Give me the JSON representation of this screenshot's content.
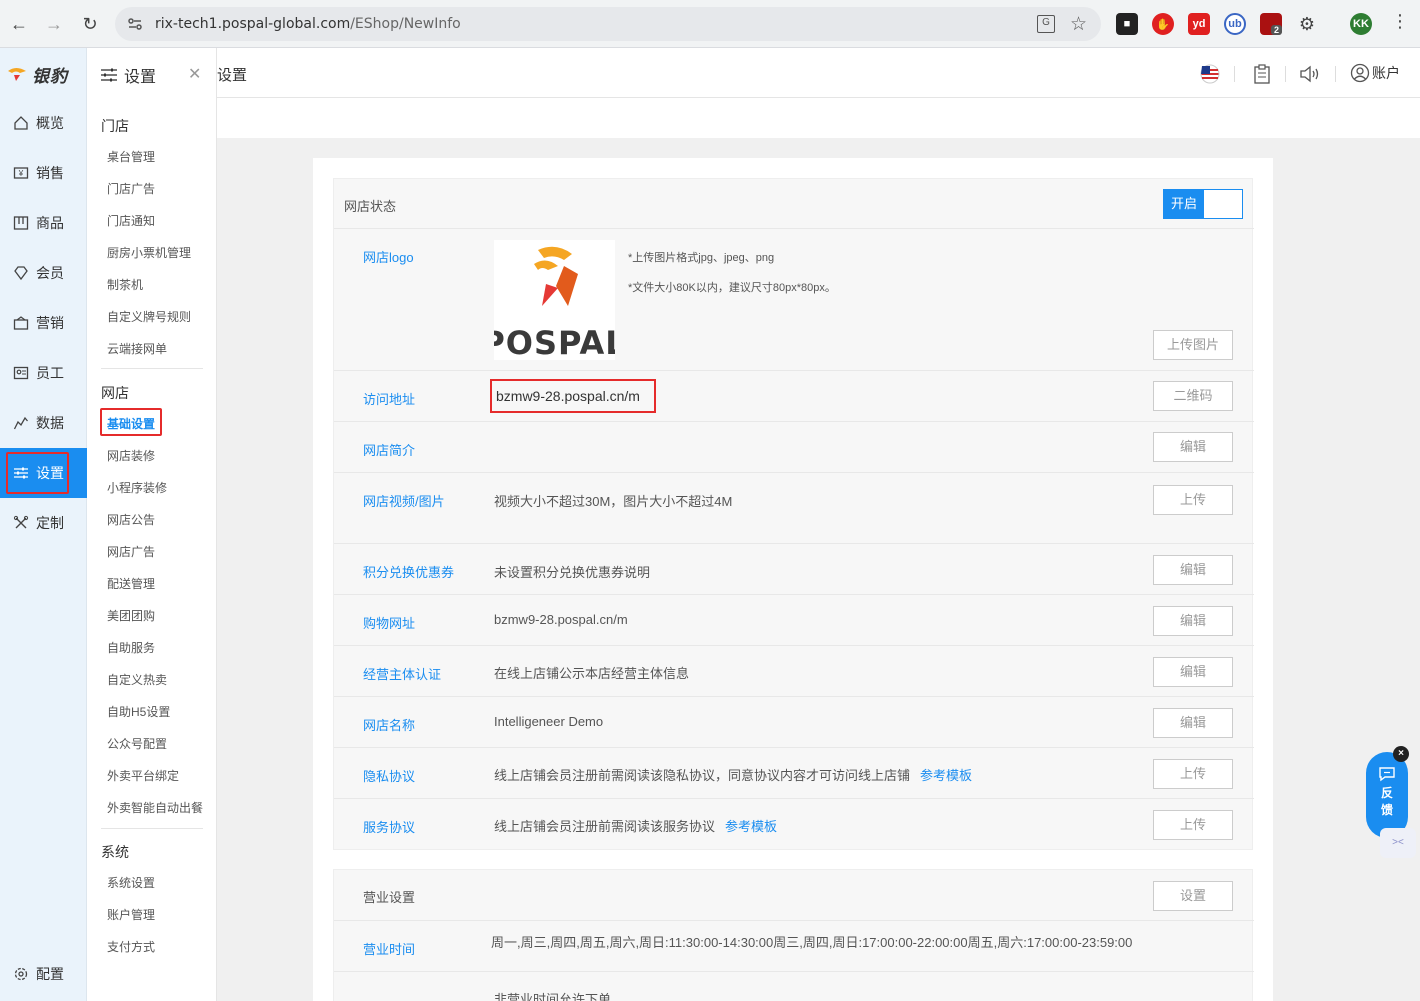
{
  "browser": {
    "url_host": "rix-tech1.pospal-global.com",
    "url_path": "/EShop/NewInfo",
    "profile_initials": "KK",
    "ext_badge": "2",
    "ext_yd_label": "yd",
    "ext_ub_label": "ub"
  },
  "mainnav": {
    "brand": "银豹",
    "items": [
      {
        "label": "概览",
        "icon": "home-icon"
      },
      {
        "label": "销售",
        "icon": "sales-icon"
      },
      {
        "label": "商品",
        "icon": "product-icon"
      },
      {
        "label": "会员",
        "icon": "member-icon"
      },
      {
        "label": "营销",
        "icon": "marketing-icon"
      },
      {
        "label": "员工",
        "icon": "employee-icon"
      },
      {
        "label": "数据",
        "icon": "data-icon"
      },
      {
        "label": "设置",
        "icon": "settings-icon"
      },
      {
        "label": "定制",
        "icon": "custom-icon"
      }
    ],
    "bottom": "配置"
  },
  "subnav": {
    "title": "设置",
    "sections": [
      {
        "title": "门店",
        "items": [
          "桌台管理",
          "门店广告",
          "门店通知",
          "厨房小票机管理",
          "制茶机",
          "自定义牌号规则",
          "云端接网单"
        ]
      },
      {
        "title": "网店",
        "items": [
          "基础设置",
          "网店装修",
          "小程序装修",
          "网店公告",
          "网店广告",
          "配送管理",
          "美团团购",
          "自助服务",
          "自定义热卖",
          "自助H5设置",
          "公众号配置",
          "外卖平台绑定",
          "外卖智能自动出餐"
        ]
      },
      {
        "title": "系统",
        "items": [
          "系统设置",
          "账户管理",
          "支付方式"
        ]
      }
    ]
  },
  "header": {
    "title": "设置",
    "account": "账户"
  },
  "shop": {
    "status_label": "网店状态",
    "toggle_on": "开启",
    "logo_label": "网店logo",
    "logo_text": "POSPAL",
    "logo_hint1": "*上传图片格式jpg、jpeg、png",
    "logo_hint2": "*文件大小80K以内，建议尺寸80px*80px。",
    "upload_image": "上传图片",
    "rows": [
      {
        "label": "访问地址",
        "value": "bzmw9-28.pospal.cn/m",
        "button": "二维码"
      },
      {
        "label": "网店简介",
        "value": "",
        "button": "编辑"
      },
      {
        "label": "网店视频/图片",
        "value": "视频大小不超过30M，图片大小不超过4M",
        "button": "上传"
      },
      {
        "label": "积分兑换优惠券",
        "value": "未设置积分兑换优惠券说明",
        "button": "编辑"
      },
      {
        "label": "购物网址",
        "value": "bzmw9-28.pospal.cn/m",
        "button": "编辑"
      },
      {
        "label": "经营主体认证",
        "value": "在线上店铺公示本店经营主体信息",
        "button": "编辑"
      },
      {
        "label": "网店名称",
        "value": "Intelligeneer Demo",
        "button": "编辑"
      },
      {
        "label": "隐私协议",
        "value": "线上店铺会员注册前需阅读该隐私协议，同意协议内容才可访问线上店铺",
        "link": "参考模板",
        "button": "上传"
      },
      {
        "label": "服务协议",
        "value": "线上店铺会员注册前需阅读该服务协议",
        "link": "参考模板",
        "button": "上传"
      }
    ]
  },
  "business": {
    "title": "营业设置",
    "button": "设置",
    "hours_label": "营业时间",
    "hours_value": "周一,周三,周四,周五,周六,周日:11:30:00-14:30:00周三,周四,周日:17:00:00-22:00:00周五,周六:17:00:00-23:59:00",
    "offhours_value": "非营业时间允许下单"
  },
  "feedback": {
    "label1": "反",
    "label2": "馈",
    "close": "×"
  },
  "colors": {
    "accent": "#1a8df0",
    "highlight_red": "#e52b2b"
  }
}
